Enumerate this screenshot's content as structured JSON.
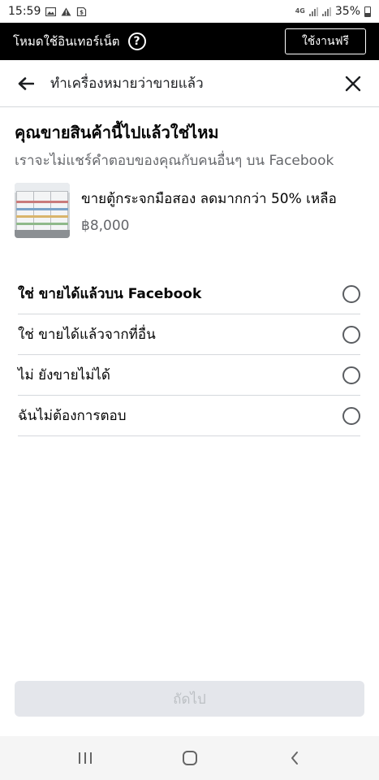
{
  "status_bar": {
    "time": "15:59",
    "battery": "35%",
    "network": "4G"
  },
  "free_mode": {
    "label": "โหมดใช้อินเทอร์เน็ต",
    "help": "?",
    "button": "ใช้งานฟรี"
  },
  "header": {
    "title": "ทำเครื่องหมายว่าขายแล้ว"
  },
  "question": "คุณขายสินค้านี้ไปแล้วใช่ไหม",
  "subtitle": "เราจะไม่แชร์คำตอบของคุณกับคนอื่นๆ บน Facebook",
  "item": {
    "title": "ขายตู้กระจกมือสอง ลดมากกว่า 50% เหลือ",
    "price": "฿8,000"
  },
  "options": [
    {
      "label": "ใช่ ขายได้แล้วบน Facebook",
      "selected": false
    },
    {
      "label": "ใช่ ขายได้แล้วจากที่อื่น",
      "selected": false
    },
    {
      "label": "ไม่ ยังขายไม่ได้",
      "selected": false
    },
    {
      "label": "ฉันไม่ต้องการตอบ",
      "selected": false
    }
  ],
  "next_button": "ถัดไป",
  "colors": {
    "accent": "#000000",
    "disabled_button": "#e4e6eb",
    "disabled_text": "#bcc0c4",
    "secondary_text": "#65676b"
  },
  "icons": [
    "image-icon",
    "warning-icon",
    "sim-icon",
    "signal-icon",
    "battery-icon",
    "back-arrow-icon",
    "close-icon",
    "recent-apps-icon",
    "home-icon",
    "nav-back-icon"
  ]
}
